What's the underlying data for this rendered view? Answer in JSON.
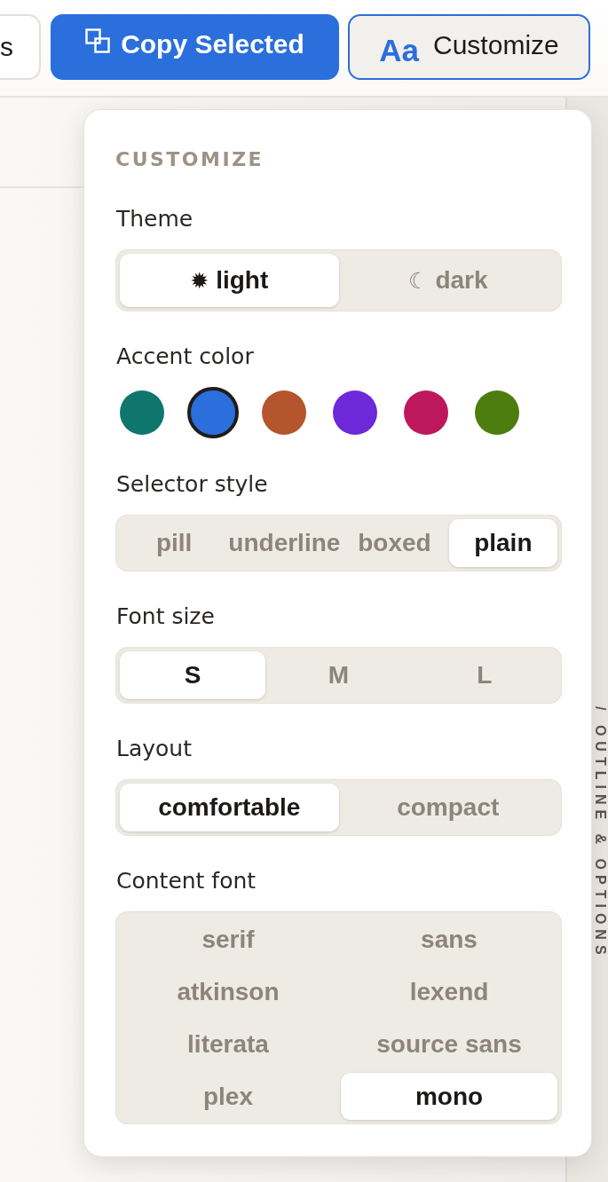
{
  "toolbar": {
    "buttons": [
      {
        "kind": "plain",
        "label": "s"
      },
      {
        "kind": "primary",
        "label": "Copy Selected"
      },
      {
        "kind": "outline",
        "badge": "Aa",
        "label": "Customize"
      }
    ]
  },
  "side_tab": {
    "label": "/ OUTLINE & OPTIONS"
  },
  "customize_panel": {
    "heading": "CUSTOMIZE",
    "sections": [
      {
        "kind": "segmented",
        "label": "Theme",
        "options": [
          {
            "icon": "✹",
            "label": "light",
            "selected": true
          },
          {
            "icon": "☾",
            "label": "dark",
            "selected": false
          }
        ]
      },
      {
        "kind": "swatches",
        "label": "Accent color",
        "swatches": [
          {
            "color": "#0f766e",
            "selected": false
          },
          {
            "color": "#2b6fdc",
            "selected": true
          },
          {
            "color": "#b4552d",
            "selected": false
          },
          {
            "color": "#6d28d9",
            "selected": false
          },
          {
            "color": "#be185d",
            "selected": false
          },
          {
            "color": "#4d7c0f",
            "selected": false
          }
        ]
      },
      {
        "kind": "segmented",
        "label": "Selector style",
        "options": [
          {
            "label": "pill",
            "selected": false
          },
          {
            "label": "underline",
            "selected": false
          },
          {
            "label": "boxed",
            "selected": false
          },
          {
            "label": "plain",
            "selected": true
          }
        ]
      },
      {
        "kind": "segmented",
        "label": "Font size",
        "options": [
          {
            "label": "S",
            "selected": true
          },
          {
            "label": "M",
            "selected": false
          },
          {
            "label": "L",
            "selected": false
          }
        ]
      },
      {
        "kind": "segmented",
        "label": "Layout",
        "options": [
          {
            "label": "comfortable",
            "selected": true
          },
          {
            "label": "compact",
            "selected": false
          }
        ]
      },
      {
        "kind": "grid",
        "label": "Content font",
        "options": [
          {
            "label": "serif",
            "selected": false
          },
          {
            "label": "sans",
            "selected": false
          },
          {
            "label": "atkinson",
            "selected": false
          },
          {
            "label": "lexend",
            "selected": false
          },
          {
            "label": "literata",
            "selected": false
          },
          {
            "label": "source sans",
            "selected": false
          },
          {
            "label": "plex",
            "selected": false
          },
          {
            "label": "mono",
            "selected": true
          }
        ]
      }
    ]
  }
}
